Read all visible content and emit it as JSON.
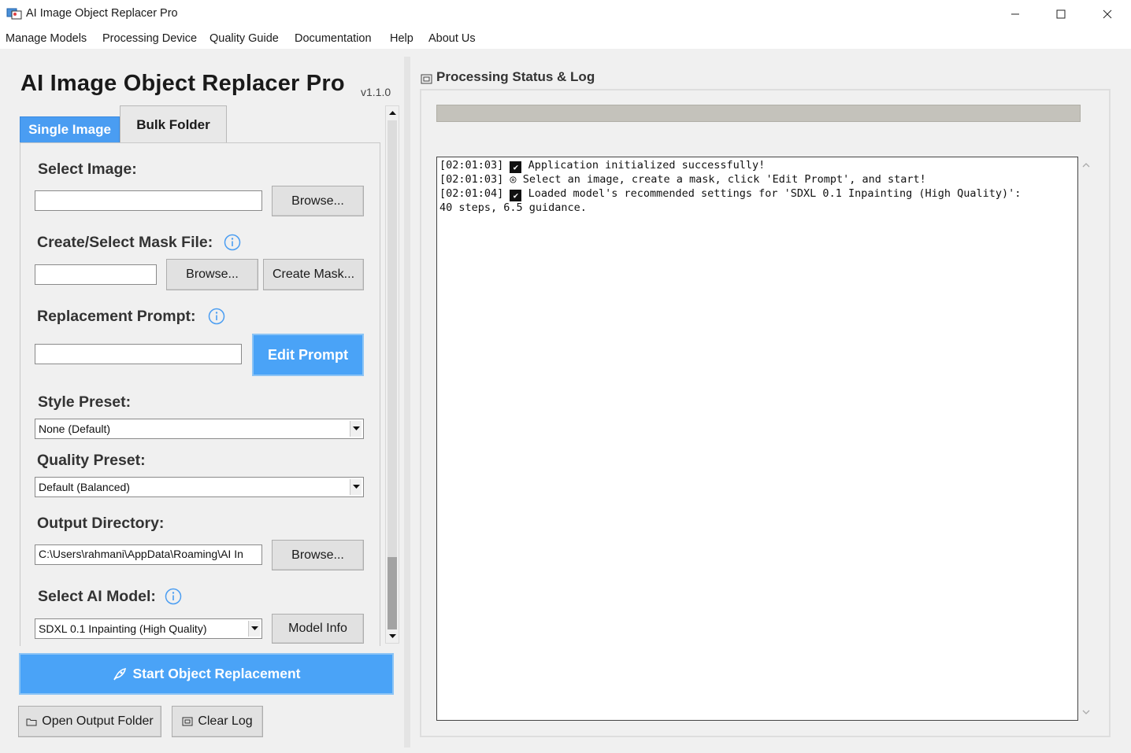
{
  "window": {
    "title": "AI Image Object Replacer Pro"
  },
  "menu": {
    "items": [
      "Manage Models",
      "Processing Device",
      "Quality Guide",
      "Documentation",
      "Help",
      "About Us"
    ]
  },
  "header": {
    "title": "AI Image Object Replacer Pro",
    "version": "v1.1.0"
  },
  "tabs": {
    "single": "Single Image",
    "bulk": "Bulk Folder"
  },
  "form": {
    "select_image_label": "Select Image:",
    "image_path_value": "",
    "browse_label": "Browse...",
    "mask_label": "Create/Select Mask File:",
    "mask_path_value": "",
    "mask_browse_label": "Browse...",
    "create_mask_label": "Create Mask...",
    "prompt_label": "Replacement Prompt:",
    "prompt_value": "",
    "edit_prompt_label": "Edit Prompt",
    "style_label": "Style Preset:",
    "style_value": "None (Default)",
    "quality_label": "Quality Preset:",
    "quality_value": "Default (Balanced)",
    "output_label": "Output Directory:",
    "output_value": "C:\\Users\\rahmani\\AppData\\Roaming\\AI In",
    "output_browse_label": "Browse...",
    "model_label": "Select AI Model:",
    "model_value": "SDXL 0.1 Inpainting (High Quality)",
    "model_info_label": "Model Info"
  },
  "actions": {
    "start_label": "Start Object Replacement",
    "open_output_label": "Open Output Folder",
    "clear_log_label": "Clear Log"
  },
  "status": {
    "title": "Processing Status & Log",
    "progress": 0,
    "log": [
      {
        "time": "[02:01:03]",
        "icon": "check-icon",
        "text": "Application initialized successfully!"
      },
      {
        "time": "[02:01:03]",
        "icon": "target-icon",
        "text": "Select an image, create a mask, click 'Edit Prompt', and start!"
      },
      {
        "time": "[02:01:04]",
        "icon": "check-icon",
        "text": "Loaded model's recommended settings for 'SDXL 0.1 Inpainting (High Quality)':"
      },
      {
        "time": "",
        "icon": "",
        "text": "40 steps, 6.5 guidance."
      }
    ]
  },
  "colors": {
    "accent": "#4aa3f7",
    "progress_bar": "#c4c2bb"
  }
}
